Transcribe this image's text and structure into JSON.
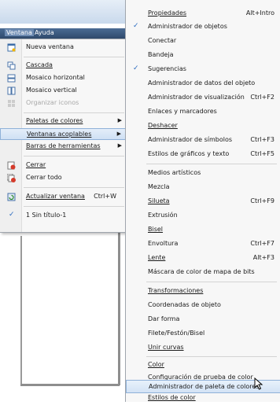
{
  "menubar": {
    "ventana": "Ventana",
    "ayuda": "Ayuda"
  },
  "left_menu": [
    {
      "label": "Nueva ventana",
      "icon": "new-window-icon"
    },
    {
      "label": "Cascada",
      "icon": "cascade-icon"
    },
    {
      "label": "Mosaico horizontal",
      "icon": "tile-horizontal-icon"
    },
    {
      "label": "Mosaico vertical",
      "icon": "tile-vertical-icon"
    },
    {
      "label": "Organizar iconos",
      "icon": "arrange-icons-icon",
      "disabled": true
    },
    {
      "label": "Paletas de colores",
      "submenu": true
    },
    {
      "label": "Ventanas acoplables",
      "submenu": true,
      "highlighted": true
    },
    {
      "label": "Barras de herramientas",
      "submenu": true
    },
    {
      "label": "Cerrar",
      "icon": "close-doc-icon"
    },
    {
      "label": "Cerrar todo",
      "icon": "close-all-icon"
    },
    {
      "label": "Actualizar ventana",
      "shortcut": "Ctrl+W",
      "icon": "refresh-window-icon"
    },
    {
      "label": "1 Sin título-1",
      "checked": true
    }
  ],
  "right_menu": [
    {
      "label": "Propiedades",
      "shortcut": "Alt+Intro"
    },
    {
      "label": "Administrador de objetos",
      "checked": true
    },
    {
      "label": "Conectar"
    },
    {
      "label": "Bandeja"
    },
    {
      "label": "Sugerencias",
      "checked": true
    },
    {
      "label": "Administrador de datos del objeto"
    },
    {
      "label": "Administrador de visualización",
      "shortcut": "Ctrl+F2"
    },
    {
      "label": "Enlaces y marcadores"
    },
    {
      "label": "Deshacer"
    },
    {
      "label": "Administrador de símbolos",
      "shortcut": "Ctrl+F3"
    },
    {
      "label": "Estilos de gráficos y texto",
      "shortcut": "Ctrl+F5"
    },
    {
      "label": "Medios artísticos"
    },
    {
      "label": "Mezcla"
    },
    {
      "label": "Silueta",
      "shortcut": "Ctrl+F9"
    },
    {
      "label": "Extrusión"
    },
    {
      "label": "Bisel"
    },
    {
      "label": "Envoltura",
      "shortcut": "Ctrl+F7"
    },
    {
      "label": "Lente",
      "shortcut": "Alt+F3"
    },
    {
      "label": "Máscara de color de mapa de bits"
    },
    {
      "label": "Transformaciones"
    },
    {
      "label": "Coordenadas de objeto"
    },
    {
      "label": "Dar forma"
    },
    {
      "label": "Filete/Festón/Bisel"
    },
    {
      "label": "Unir curvas"
    },
    {
      "label": "Color"
    },
    {
      "label": "Configuración de prueba de color"
    },
    {
      "label": "Administrador de paleta de colores",
      "highlighted": true
    },
    {
      "label": "Estilos de color"
    }
  ],
  "colors": {
    "highlight_border": "#8fb1d8",
    "check": "#2b6bbf",
    "menubar": "#2f4a6c"
  }
}
